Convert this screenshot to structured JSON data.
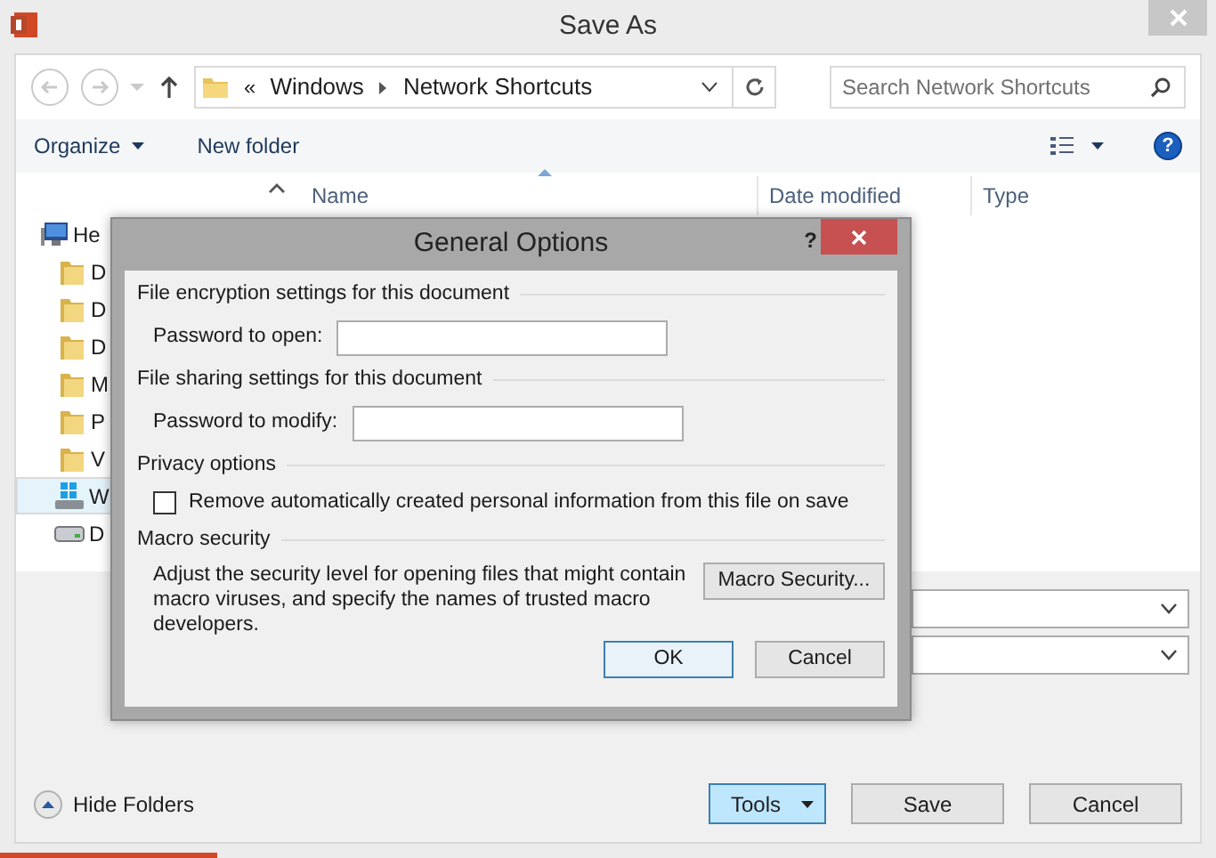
{
  "window": {
    "title": "Save As"
  },
  "address_bar": {
    "overflow": "«",
    "segments": [
      "Windows",
      "Network Shortcuts"
    ]
  },
  "search": {
    "placeholder": "Search Network Shortcuts"
  },
  "toolbar": {
    "organize": "Organize",
    "new_folder": "New folder",
    "help": "?"
  },
  "columns": [
    "Name",
    "Date modified",
    "Type"
  ],
  "sidebar": {
    "items": [
      {
        "label": "He",
        "kind": "computer",
        "selected": false
      },
      {
        "label": "D",
        "kind": "folder",
        "selected": false
      },
      {
        "label": "D",
        "kind": "folder",
        "selected": false
      },
      {
        "label": "D",
        "kind": "folder",
        "selected": false
      },
      {
        "label": "M",
        "kind": "folder",
        "selected": false
      },
      {
        "label": "P",
        "kind": "folder",
        "selected": false
      },
      {
        "label": "V",
        "kind": "folder",
        "selected": false
      },
      {
        "label": "W",
        "kind": "system",
        "selected": true
      },
      {
        "label": "D",
        "kind": "drive",
        "selected": false
      }
    ]
  },
  "hide_folders": "Hide Folders",
  "buttons": [
    {
      "label": "Tools",
      "kind": "dropdown"
    },
    {
      "label": "Save",
      "kind": "plain"
    },
    {
      "label": "Cancel",
      "kind": "plain"
    }
  ],
  "dialog": {
    "title": "General Options",
    "help": "?",
    "sections": [
      {
        "heading": "File encryption settings for this document",
        "kind": "password",
        "label": "Password to open:"
      },
      {
        "heading": "File sharing settings for this document",
        "kind": "password",
        "label": "Password to modify:"
      },
      {
        "heading": "Privacy options",
        "kind": "checkbox",
        "label": "Remove automatically created personal information from this file on save",
        "checked": false
      },
      {
        "heading": "Macro security",
        "kind": "macro",
        "description": "Adjust the security level for opening files that might contain macro viruses, and specify the names of trusted macro developers.",
        "button": "Macro Security..."
      }
    ],
    "buttons": [
      {
        "label": "OK",
        "default": true
      },
      {
        "label": "Cancel",
        "default": false
      }
    ]
  }
}
